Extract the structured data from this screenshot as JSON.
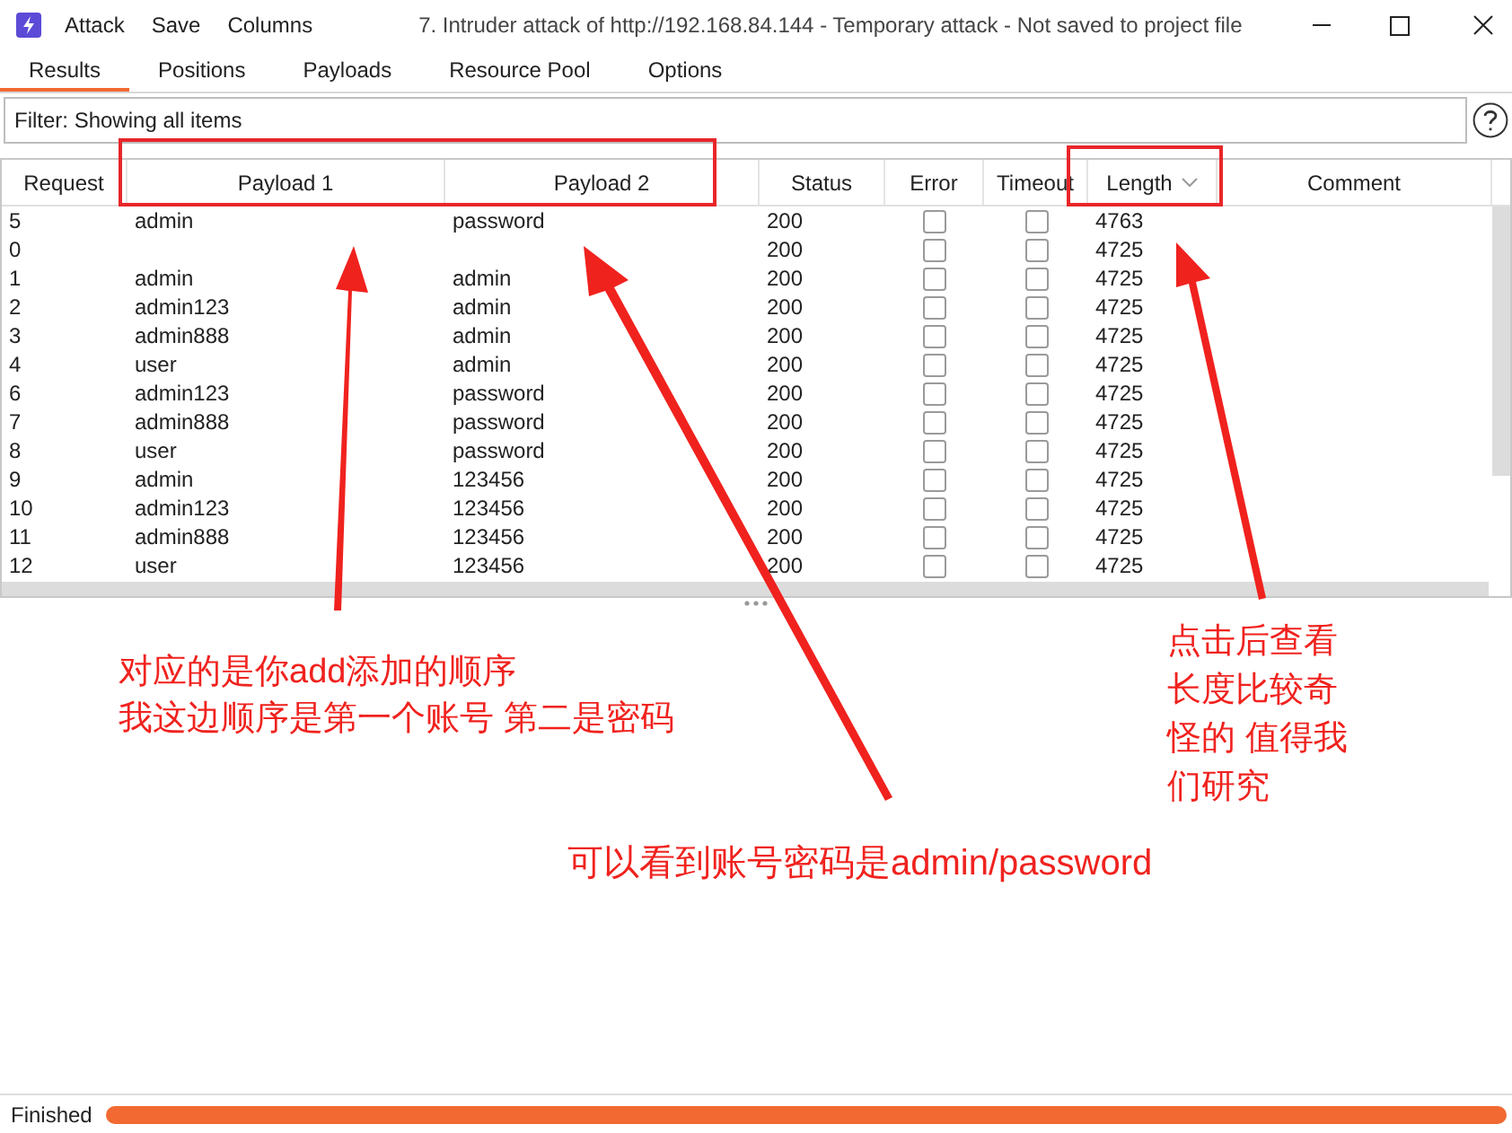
{
  "window": {
    "menu": [
      "Attack",
      "Save",
      "Columns"
    ],
    "title": "7. Intruder attack of http://192.168.84.144 - Temporary attack - Not saved to project file"
  },
  "tabs": [
    {
      "label": "Results",
      "selected": true
    },
    {
      "label": "Positions",
      "selected": false
    },
    {
      "label": "Payloads",
      "selected": false
    },
    {
      "label": "Resource Pool",
      "selected": false
    },
    {
      "label": "Options",
      "selected": false
    }
  ],
  "filter": {
    "value": "Filter: Showing all items"
  },
  "table": {
    "columns": [
      "Request",
      "Payload 1",
      "Payload 2",
      "Status",
      "Error",
      "Timeout",
      "Length",
      "Comment"
    ],
    "rows": [
      {
        "request": "5",
        "payload_1": "admin",
        "payload_2": "password",
        "status": "200",
        "error": false,
        "timeout": false,
        "length": "4763"
      },
      {
        "request": "0",
        "payload_1": "",
        "payload_2": "",
        "status": "200",
        "error": false,
        "timeout": false,
        "length": "4725"
      },
      {
        "request": "1",
        "payload_1": "admin",
        "payload_2": "admin",
        "status": "200",
        "error": false,
        "timeout": false,
        "length": "4725"
      },
      {
        "request": "2",
        "payload_1": "admin123",
        "payload_2": "admin",
        "status": "200",
        "error": false,
        "timeout": false,
        "length": "4725"
      },
      {
        "request": "3",
        "payload_1": "admin888",
        "payload_2": "admin",
        "status": "200",
        "error": false,
        "timeout": false,
        "length": "4725"
      },
      {
        "request": "4",
        "payload_1": "user",
        "payload_2": "admin",
        "status": "200",
        "error": false,
        "timeout": false,
        "length": "4725"
      },
      {
        "request": "6",
        "payload_1": "admin123",
        "payload_2": "password",
        "status": "200",
        "error": false,
        "timeout": false,
        "length": "4725"
      },
      {
        "request": "7",
        "payload_1": "admin888",
        "payload_2": "password",
        "status": "200",
        "error": false,
        "timeout": false,
        "length": "4725"
      },
      {
        "request": "8",
        "payload_1": "user",
        "payload_2": "password",
        "status": "200",
        "error": false,
        "timeout": false,
        "length": "4725"
      },
      {
        "request": "9",
        "payload_1": "admin",
        "payload_2": "123456",
        "status": "200",
        "error": false,
        "timeout": false,
        "length": "4725"
      },
      {
        "request": "10",
        "payload_1": "admin123",
        "payload_2": "123456",
        "status": "200",
        "error": false,
        "timeout": false,
        "length": "4725"
      },
      {
        "request": "11",
        "payload_1": "admin888",
        "payload_2": "123456",
        "status": "200",
        "error": false,
        "timeout": false,
        "length": "4725"
      },
      {
        "request": "12",
        "payload_1": "user",
        "payload_2": "123456",
        "status": "200",
        "error": false,
        "timeout": false,
        "length": "4725"
      }
    ]
  },
  "annotations": [
    {
      "lines": [
        "对应的是你add添加的顺序",
        "我这边顺序是第一个账号 第二是密码"
      ]
    },
    {
      "lines": [
        "可以看到账号密码是admin/password"
      ]
    },
    {
      "lines": [
        "点击后查看",
        "长度比较奇",
        "怪的 值得我",
        "们研究"
      ]
    }
  ],
  "status_bar": {
    "text": "Finished",
    "level": 1
  }
}
